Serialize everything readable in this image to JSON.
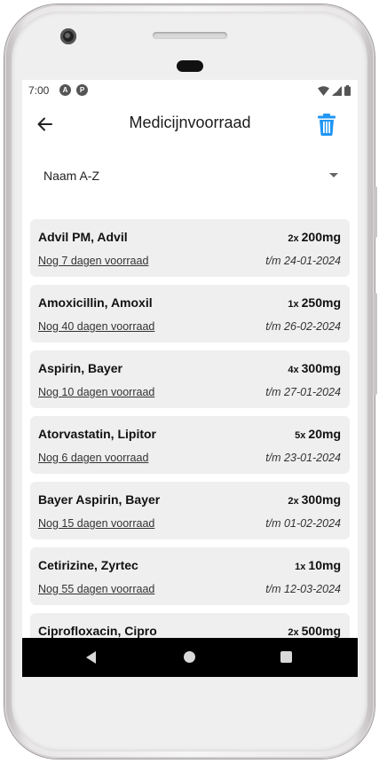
{
  "status": {
    "time": "7:00",
    "icon1": "A",
    "icon2": "P"
  },
  "appbar": {
    "title": "Medicijnvoorraad"
  },
  "sort": {
    "selected": "Naam A-Z"
  },
  "items": [
    {
      "name": "Advil PM, Advil",
      "qty": "2x",
      "dose": "200mg",
      "stock": "Nog 7 dagen voorraad",
      "until": "t/m 24-01-2024"
    },
    {
      "name": "Amoxicillin, Amoxil",
      "qty": "1x",
      "dose": "250mg",
      "stock": "Nog 40 dagen voorraad",
      "until": "t/m 26-02-2024"
    },
    {
      "name": "Aspirin, Bayer",
      "qty": "4x",
      "dose": "300mg",
      "stock": "Nog 10 dagen voorraad",
      "until": "t/m 27-01-2024"
    },
    {
      "name": "Atorvastatin, Lipitor",
      "qty": "5x",
      "dose": "20mg",
      "stock": "Nog 6 dagen voorraad",
      "until": "t/m 23-01-2024"
    },
    {
      "name": "Bayer Aspirin, Bayer",
      "qty": "2x",
      "dose": "300mg",
      "stock": "Nog 15 dagen voorraad",
      "until": "t/m 01-02-2024"
    },
    {
      "name": "Cetirizine, Zyrtec",
      "qty": "1x",
      "dose": "10mg",
      "stock": "Nog 55 dagen voorraad",
      "until": "t/m 12-03-2024"
    },
    {
      "name": "Ciprofloxacin, Cipro",
      "qty": "2x",
      "dose": "500mg",
      "stock": "",
      "until": ""
    }
  ],
  "colors": {
    "accent": "#2196f3",
    "card": "#efefef",
    "navbar": "#000000"
  }
}
